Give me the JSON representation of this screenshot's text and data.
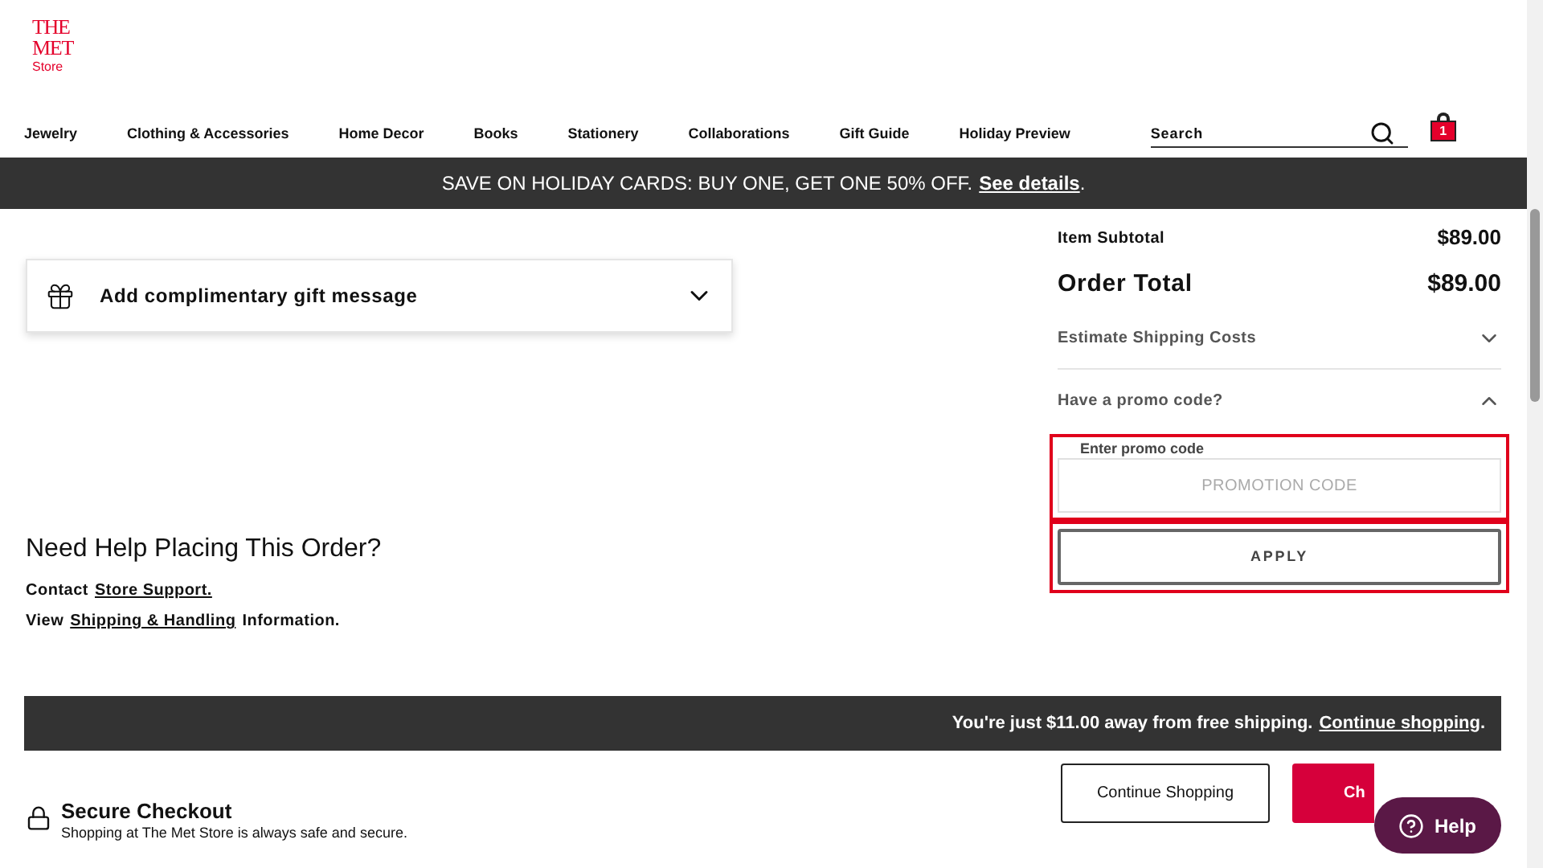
{
  "logo": {
    "line_1": "THE",
    "line_2": "MET",
    "line_3": "Store"
  },
  "nav": [
    {
      "label": "Jewelry"
    },
    {
      "label": "Clothing & Accessories"
    },
    {
      "label": "Home Decor"
    },
    {
      "label": "Books"
    },
    {
      "label": "Stationery"
    },
    {
      "label": "Collaborations"
    },
    {
      "label": "Gift Guide"
    },
    {
      "label": "Holiday Preview"
    }
  ],
  "search": {
    "placeholder": "Search"
  },
  "cart": {
    "count": "1"
  },
  "promo_banner": {
    "text": "SAVE ON HOLIDAY CARDS: BUY ONE, GET ONE 50% OFF.",
    "link": "See details",
    "end": "."
  },
  "gift_message": {
    "label": "Add complimentary gift message",
    "expanded": false
  },
  "help": {
    "title": "Need Help Placing This Order?",
    "line_1_prefix": "Contact",
    "line_1_link": "Store Support.",
    "line_2_prefix": "View",
    "line_2_link": "Shipping & Handling",
    "line_2_suffix": "Information."
  },
  "summary": {
    "subtotal_label": "Item Subtotal",
    "subtotal_value": "$89.00",
    "total_label": "Order Total",
    "total_value": "$89.00",
    "sections": [
      {
        "label": "Estimate Shipping Costs",
        "expanded": false
      },
      {
        "label": "Have a promo code?",
        "expanded": true
      }
    ],
    "promo_field": {
      "label": "Enter promo code",
      "placeholder": "PROMOTION CODE",
      "highlighted": true
    },
    "apply_button": {
      "label": "APPLY",
      "highlighted": true
    }
  },
  "shipping_bar": {
    "text": "You're just $11.00 away from free shipping.",
    "link": "Continue shopping",
    "end": "."
  },
  "buttons": {
    "continue": "Continue Shopping",
    "checkout": "Ch"
  },
  "help_button": {
    "label": "Help"
  },
  "secure": {
    "title": "Secure Checkout",
    "text": "Shopping at The Met Store is always safe and secure."
  }
}
